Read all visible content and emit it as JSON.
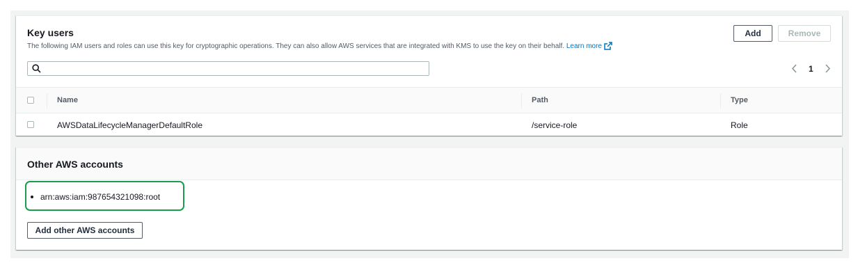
{
  "key_users": {
    "title": "Key users",
    "description": "The following IAM users and roles can use this key for cryptographic operations. They can also allow AWS services that are integrated with KMS to use the key on their behalf.",
    "learn_more": "Learn more",
    "add_label": "Add",
    "remove_label": "Remove",
    "search_placeholder": "",
    "page_number": "1",
    "prev_glyph": "‹",
    "next_glyph": "›",
    "columns": {
      "name": "Name",
      "path": "Path",
      "type": "Type"
    },
    "rows": [
      {
        "name": "AWSDataLifecycleManagerDefaultRole",
        "path": "/service-role",
        "type": "Role"
      }
    ]
  },
  "other_accounts": {
    "title": "Other AWS accounts",
    "items": [
      "arn:aws:iam:987654321098:root"
    ],
    "add_button_label": "Add other AWS accounts"
  },
  "colors": {
    "link": "#0073bb",
    "highlight": "#1a9c4a",
    "background": "#f2f3f3"
  },
  "icons": {
    "search": "search-icon",
    "external_link": "external-link-icon"
  }
}
